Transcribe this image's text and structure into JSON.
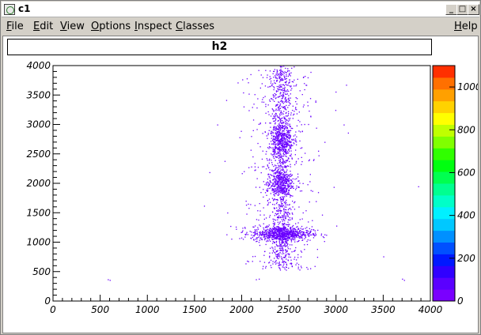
{
  "window": {
    "title": "c1"
  },
  "menubar": {
    "items": [
      "File",
      "Edit",
      "View",
      "Options",
      "Inspect",
      "Classes"
    ],
    "help": "Help"
  },
  "title_buttons": {
    "minimize": "_",
    "maximize": "□",
    "close": "×"
  },
  "chart_data": {
    "type": "heatmap",
    "title": "h2",
    "xlabel": "",
    "ylabel": "",
    "xlim": [
      0,
      4000
    ],
    "ylim": [
      0,
      4000
    ],
    "x_ticks": [
      0,
      500,
      1000,
      1500,
      2000,
      2500,
      3000,
      3500,
      4000
    ],
    "y_ticks": [
      0,
      500,
      1000,
      1500,
      2000,
      2500,
      3000,
      3500,
      4000
    ],
    "colorbar": {
      "range": [
        0,
        1100
      ],
      "ticks": [
        0,
        200,
        400,
        600,
        800,
        1000
      ],
      "tick_labels": [
        "0",
        "200",
        "400",
        "600",
        "800",
        "1000"
      ],
      "colors": [
        "#7a00ff",
        "#5a00ff",
        "#3000ff",
        "#0018ff",
        "#0050ff",
        "#0090ff",
        "#00c8ff",
        "#00f0ff",
        "#00ffc8",
        "#00ff90",
        "#00ff50",
        "#00ff10",
        "#30ff00",
        "#80ff00",
        "#c0ff00",
        "#ffff00",
        "#ffd200",
        "#ffa000",
        "#ff7000",
        "#ff3000"
      ]
    },
    "point_color": "#6a00ff",
    "clusters": [
      {
        "x_center": 2420,
        "y_min": 550,
        "y_max": 4000,
        "x_spread": 55
      },
      {
        "x_center": 2420,
        "y_center": 1150,
        "x_spread": 160,
        "y_spread": 60
      },
      {
        "x_center": 2400,
        "y_center": 2000,
        "x_spread": 70,
        "y_spread": 120
      },
      {
        "x_center": 2420,
        "y_center": 2750,
        "x_spread": 60,
        "y_spread": 150
      }
    ],
    "outliers": [
      {
        "x": 580,
        "y": 370
      },
      {
        "x": 600,
        "y": 360
      },
      {
        "x": 1740,
        "y": 3000
      },
      {
        "x": 1600,
        "y": 1620
      },
      {
        "x": 3080,
        "y": 3000
      },
      {
        "x": 3700,
        "y": 380
      },
      {
        "x": 3720,
        "y": 360
      },
      {
        "x": 3870,
        "y": 1950
      },
      {
        "x": 3500,
        "y": 760
      },
      {
        "x": 2150,
        "y": 370
      },
      {
        "x": 2180,
        "y": 380
      }
    ]
  }
}
